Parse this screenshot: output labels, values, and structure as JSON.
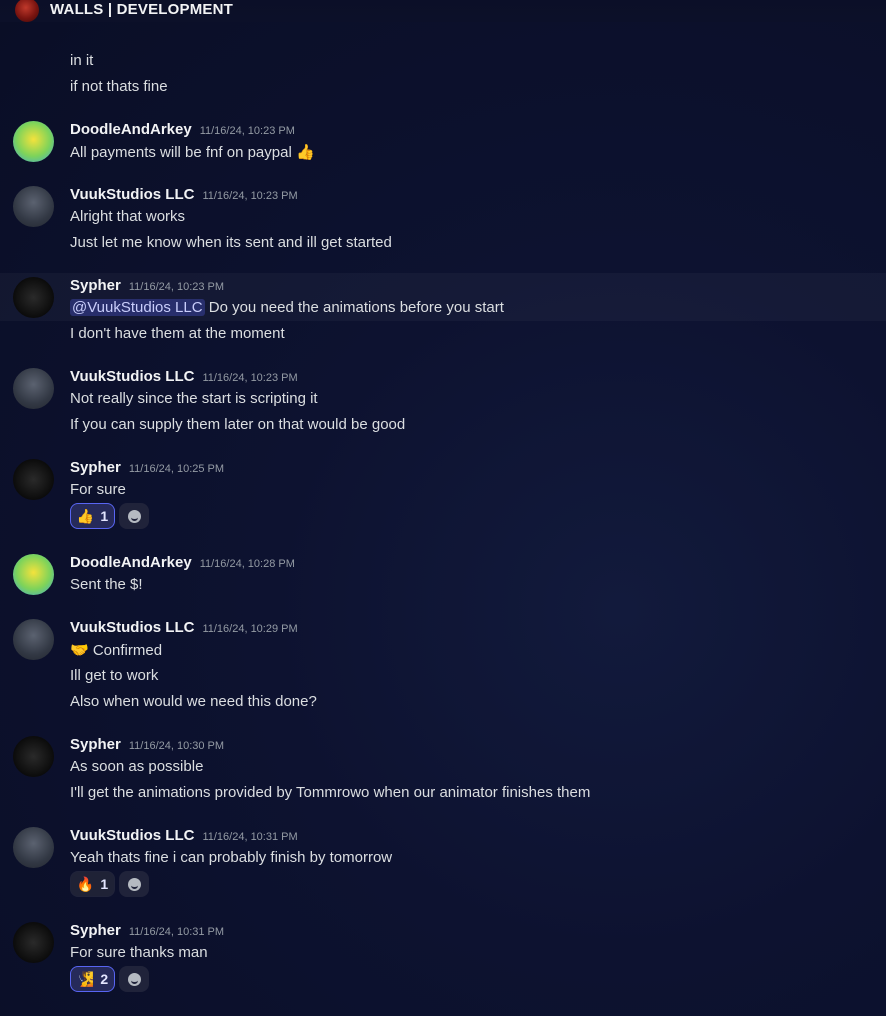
{
  "header": {
    "title": "WALLS | DEVELOPMENT"
  },
  "top": {
    "lines": [
      "in it",
      "if not thats fine"
    ]
  },
  "messages": [
    {
      "author": "DoodleAndArkey",
      "time": "11/16/24, 10:23 PM",
      "lines": [
        "All payments will be fnf on paypal 👍"
      ]
    },
    {
      "author": "VuukStudios LLC",
      "time": "11/16/24, 10:23 PM",
      "lines": [
        "Alright that works",
        "Just let me know when its sent and ill get started"
      ]
    },
    {
      "author": "Sypher",
      "time": "11/16/24, 10:23 PM",
      "mention": "@VuukStudios LLC",
      "lines": [
        "Do you need the animations before you start",
        "I don't have them at the moment"
      ]
    },
    {
      "author": "VuukStudios LLC",
      "time": "11/16/24, 10:23 PM",
      "lines": [
        "Not really since the start is scripting it",
        "If you can supply them later on that would be good"
      ]
    },
    {
      "author": "Sypher",
      "time": "11/16/24, 10:25 PM",
      "lines": [
        "For sure"
      ],
      "reaction": {
        "emoji": "👍",
        "count": "1"
      }
    },
    {
      "author": "DoodleAndArkey",
      "time": "11/16/24, 10:28 PM",
      "lines": [
        "Sent the $!"
      ]
    },
    {
      "author": "VuukStudios LLC",
      "time": "11/16/24, 10:29 PM",
      "lines": [
        "🤝 Confirmed",
        "Ill get to work",
        "Also when would we need this done?"
      ]
    },
    {
      "author": "Sypher",
      "time": "11/16/24, 10:30 PM",
      "lines": [
        "As soon as possible",
        "I'll get the animations provided by Tommrowo when our animator finishes them"
      ]
    },
    {
      "author": "VuukStudios LLC",
      "time": "11/16/24, 10:31 PM",
      "lines": [
        "Yeah thats fine i can probably finish by tomorrow"
      ],
      "reaction": {
        "emoji": "🔥",
        "count": "1"
      }
    },
    {
      "author": "Sypher",
      "time": "11/16/24, 10:31 PM",
      "lines": [
        "For sure thanks man"
      ],
      "reaction": {
        "emoji": "🧏",
        "count": "2"
      }
    }
  ]
}
